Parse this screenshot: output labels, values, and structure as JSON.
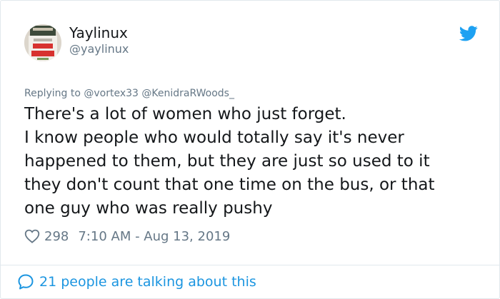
{
  "author": {
    "display_name": "Yaylinux",
    "handle": "@yaylinux"
  },
  "reply": {
    "prefix": "Replying to",
    "mentions": "@vortex33 @KenidraRWoods_"
  },
  "tweet": {
    "lines": [
      "There's a lot of women who just forget.",
      "I know people who would totally say it's never",
      "happened to them, but they are just so used to it",
      "they don't count that one time on the bus, or that",
      "one guy who was really pushy"
    ]
  },
  "meta": {
    "likes": "298",
    "timestamp": "7:10 AM - Aug 13, 2019"
  },
  "conversation": {
    "label": "21 people are talking about this"
  },
  "colors": {
    "brand_blue": "#1da1f2",
    "link_blue": "#1b95e0",
    "text_primary": "#14171a",
    "text_secondary": "#657786"
  },
  "icons": {
    "brand": "twitter-bird-icon",
    "like": "heart-outline-icon",
    "conversation": "speech-bubble-icon"
  }
}
